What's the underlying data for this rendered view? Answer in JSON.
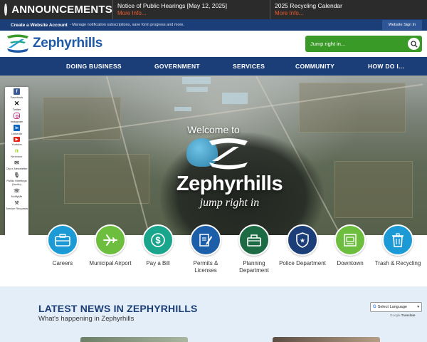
{
  "announcements": {
    "title": "ANNOUNCEMENTS",
    "items": [
      {
        "text": "Notice of Public Hearings [May 12, 2025]",
        "more": "More Info..."
      },
      {
        "text": "2025 Recycling Calendar",
        "more": "More Info..."
      }
    ]
  },
  "account_bar": {
    "create_label": "Create a Website Account",
    "create_desc": "- Manage notification subscriptions, save form progress and more.",
    "signin_label": "Website Sign In"
  },
  "logo": {
    "name": "Zephyrhills"
  },
  "search": {
    "placeholder": "Jump right in..."
  },
  "nav": {
    "items": [
      "DOING BUSINESS",
      "GOVERNMENT",
      "SERVICES",
      "COMMUNITY",
      "HOW DO I..."
    ]
  },
  "hero": {
    "welcome": "Welcome to",
    "name": "Zephyrhills",
    "tagline": "jump right in"
  },
  "social": {
    "items": [
      {
        "label": "Facebook",
        "icon": "facebook-icon",
        "color": "#3b5998"
      },
      {
        "label": "Twitter",
        "icon": "twitter-x-icon",
        "color": "#111111"
      },
      {
        "label": "Instagram",
        "icon": "instagram-icon",
        "color": "#c13584"
      },
      {
        "label": "LinkedIn",
        "icon": "linkedin-icon",
        "color": "#0a66c2"
      },
      {
        "label": "Youtube",
        "icon": "youtube-icon",
        "color": "#e62117"
      },
      {
        "label": "Nextdoor",
        "icon": "nextdoor-icon",
        "color": "#8ed500"
      },
      {
        "label": "City e-Newsletter",
        "icon": "newsletter-icon",
        "color": "#555555"
      },
      {
        "label": "Public Meetings (Audio)",
        "icon": "microphone-icon",
        "color": "#555555"
      },
      {
        "label": "NotifyMe",
        "icon": "notify-icon",
        "color": "#555555"
      },
      {
        "label": "Service Requests",
        "icon": "wrench-icon",
        "color": "#555555"
      }
    ]
  },
  "quick_links": [
    {
      "label": "Careers",
      "icon": "briefcase-icon",
      "color": "#1b9ad6"
    },
    {
      "label": "Municipal Airport",
      "icon": "airplane-icon",
      "color": "#6dbd3e"
    },
    {
      "label": "Pay a Bill",
      "icon": "dollar-icon",
      "color": "#1aa58d"
    },
    {
      "label": "Permits & Licenses",
      "icon": "document-pen-icon",
      "color": "#1c5fa8"
    },
    {
      "label": "Planning Department",
      "icon": "toolbox-icon",
      "color": "#1d6b45"
    },
    {
      "label": "Police Department",
      "icon": "badge-icon",
      "color": "#1c3e78"
    },
    {
      "label": "Downtown",
      "icon": "storefront-icon",
      "color": "#6dbd3e"
    },
    {
      "label": "Trash & Recycling",
      "icon": "trash-icon",
      "color": "#1b9ad6"
    }
  ],
  "news": {
    "title": "LATEST NEWS IN ZEPHYRHILLS",
    "subtitle": "What's happening in Zephyrhills",
    "translate_label": "Select Language",
    "powered_by": "Google",
    "translate_word": "Translate"
  },
  "colors": {
    "navy": "#1c3e78",
    "green": "#3a9a27",
    "orange": "#f05a28"
  }
}
